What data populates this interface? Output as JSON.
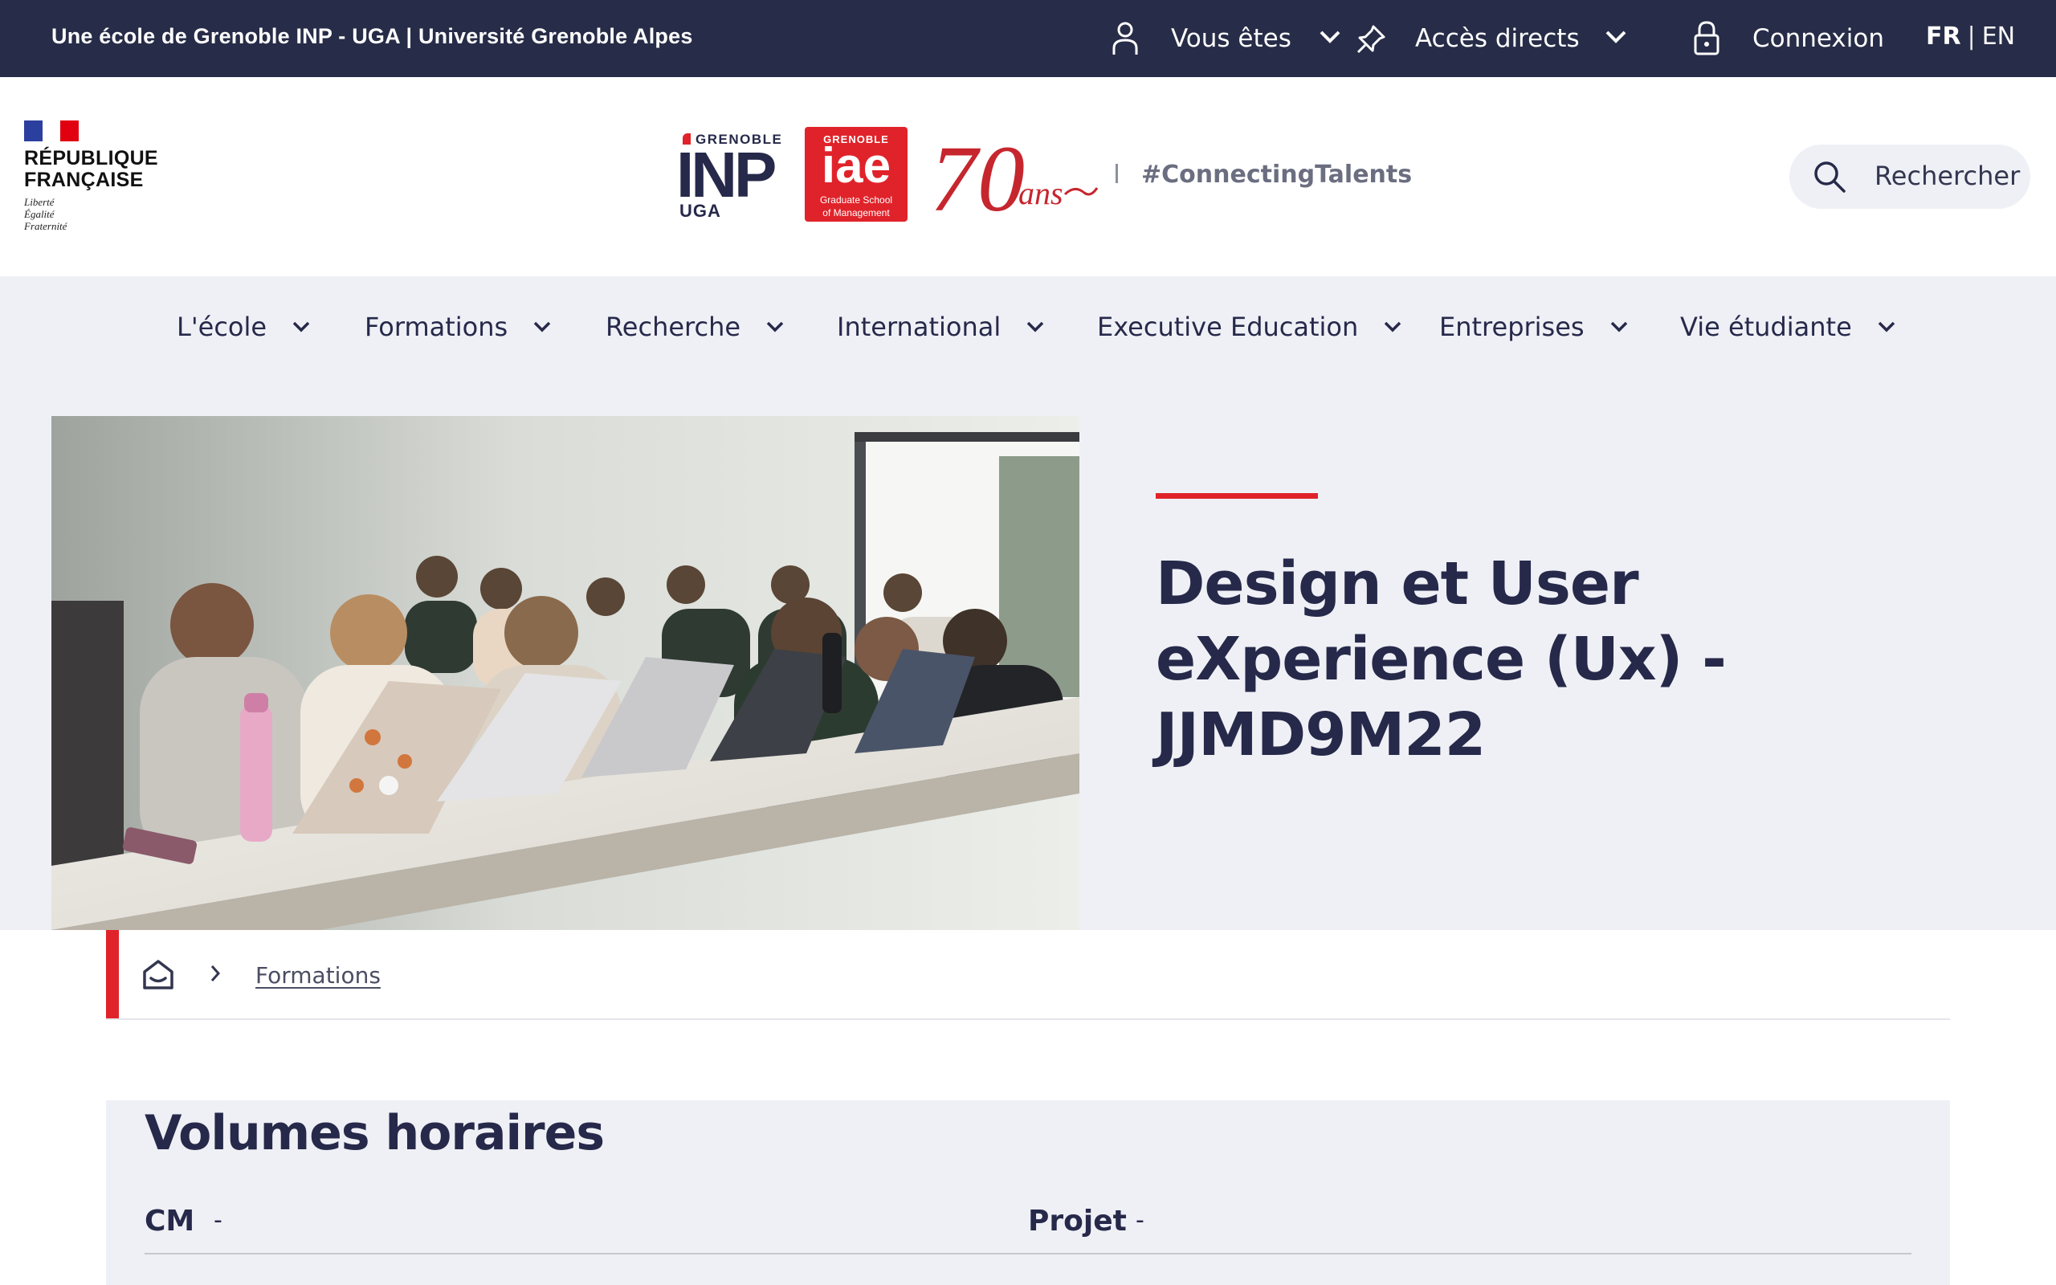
{
  "topbar": {
    "school": "Une école de Grenoble INP - UGA | Université Grenoble Alpes",
    "vous_etes": "Vous êtes",
    "acces_directs": "Accès directs",
    "connexion": "Connexion",
    "lang_fr": "FR",
    "lang_sep": "|",
    "lang_en": "EN"
  },
  "header": {
    "republique": "RÉPUBLIQUE",
    "francaise": "FRANÇAISE",
    "motto": [
      "Liberté",
      "Égalité",
      "Fraternité"
    ],
    "inp_grenoble": "GRENOBLE",
    "inp_big": "INP",
    "inp_uga": "UGA",
    "iae_grenoble": "GRENOBLE",
    "iae_word": "iae",
    "iae_sub1": "Graduate School",
    "iae_sub2": "of Management",
    "seventy_num": "70",
    "seventy_ans": "ans",
    "hashtag": "#ConnectingTalents",
    "search_label": "Rechercher"
  },
  "nav": {
    "items": [
      "L'école",
      "Formations",
      "Recherche",
      "International",
      "Executive Education",
      "Entreprises",
      "Vie étudiante"
    ]
  },
  "hero": {
    "title": "Design et User eXperience (Ux) - JJMD9M22"
  },
  "breadcrumb": {
    "link": "Formations"
  },
  "volumes": {
    "title": "Volumes horaires",
    "cm_label": "CM",
    "cm_value": "-",
    "projet_label": "Projet",
    "projet_value": "-"
  },
  "colors": {
    "navy": "#272c48",
    "red": "#e0232a",
    "light_bg": "#eff0f5"
  }
}
